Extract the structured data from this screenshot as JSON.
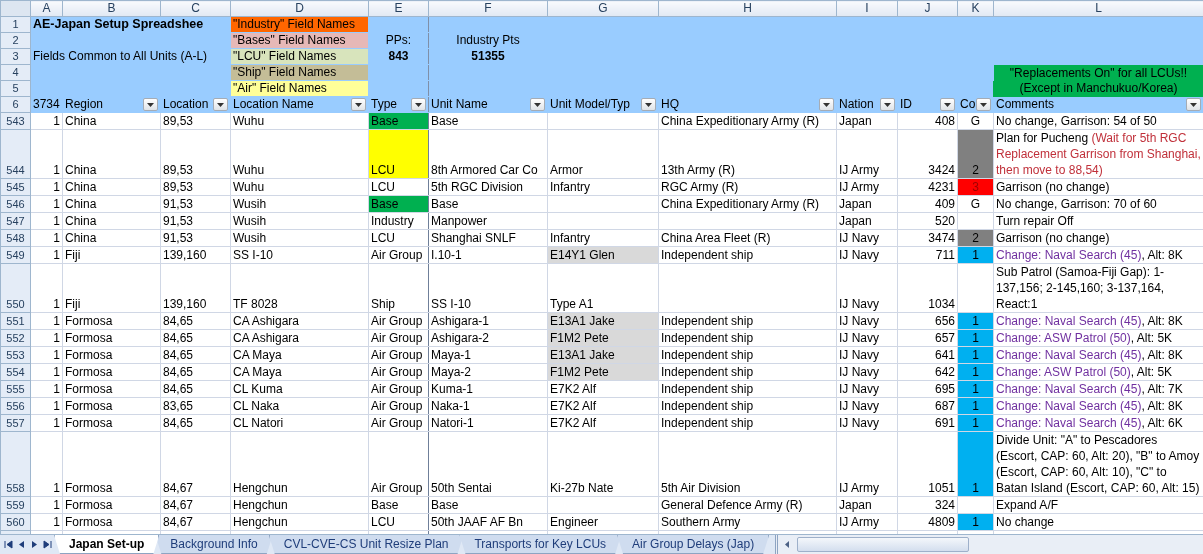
{
  "column_letters": [
    "A",
    "B",
    "C",
    "D",
    "E",
    "F",
    "G",
    "H",
    "I",
    "J",
    "K",
    "L"
  ],
  "header_row_numbers": [
    "1",
    "2",
    "3",
    "4",
    "5"
  ],
  "title": "AE-Japan Setup Spreadshee",
  "subtitle": "Fields Common to All Units (A-L)",
  "legend": [
    {
      "label": "\"Industry\" Field Names",
      "color": "#ff6600"
    },
    {
      "label": "\"Bases\" Field Names",
      "color": "#e6b8b7"
    },
    {
      "label": "\"LCU\" Field Names",
      "color": "#d8e4bc"
    },
    {
      "label": "\"Ship\" Field Names",
      "color": "#c4bd97"
    },
    {
      "label": "\"Air\" Field Names",
      "color": "#ffff99"
    }
  ],
  "pps": {
    "label": "PPs:",
    "value": "843"
  },
  "industry_pts": {
    "label": "Industry Pts",
    "value": "51355"
  },
  "banner": [
    "\"Replacements On\" for all LCUs!!",
    "(Except in Manchukuo/Korea)"
  ],
  "header_row": {
    "row_number": "6",
    "cells": [
      {
        "text": "3734",
        "filter": false
      },
      {
        "text": "Region",
        "filter": true
      },
      {
        "text": "Location",
        "filter": true
      },
      {
        "text": "Location Name",
        "filter": true
      },
      {
        "text": "Type",
        "filter": true
      },
      {
        "text": "Unit Name",
        "filter": true
      },
      {
        "text": "Unit Model/Typ",
        "filter": true
      },
      {
        "text": "HQ",
        "filter": true
      },
      {
        "text": "Nation",
        "filter": true
      },
      {
        "text": "ID",
        "filter": true
      },
      {
        "text": "Co",
        "filter": true
      },
      {
        "text": "Comments",
        "filter": true
      }
    ]
  },
  "rows": [
    {
      "row_number": "543",
      "count": "1",
      "region": "China",
      "location": "89,53",
      "location_name": "Wuhu",
      "type": {
        "text": "Base",
        "color": "#00b050"
      },
      "unit_name": "Base",
      "hq": "China Expeditionary Army (R)",
      "nation": "Japan",
      "id": "408",
      "co": {
        "text": "G"
      },
      "comment": [
        {
          "text": "No change, Garrison: 54 of 50",
          "kind": "plain"
        }
      ]
    },
    {
      "row_number": "544",
      "count": "1",
      "region": "China",
      "location": "89,53",
      "location_name": "Wuhu",
      "type": {
        "text": "LCU",
        "color": "#ffff00"
      },
      "unit_name": "8th Armored Car Co",
      "unit_model": {
        "text": "Armor"
      },
      "hq": "13th Army (R)",
      "nation": "IJ Army",
      "id": "3424",
      "co": {
        "text": "2",
        "color": "#808080"
      },
      "comment": [
        {
          "text": "Plan for Pucheng ",
          "kind": "plain"
        },
        {
          "text": "(Wait for 5th RGC Replacement Garrison from Shanghai, then move to 88,54)",
          "kind": "note"
        }
      ]
    },
    {
      "row_number": "545",
      "count": "1",
      "region": "China",
      "location": "89,53",
      "location_name": "Wuhu",
      "type": {
        "text": "LCU"
      },
      "unit_name": "5th RGC Division",
      "unit_model": {
        "text": "Infantry"
      },
      "hq": "RGC Army (R)",
      "nation": "IJ Army",
      "id": "4231",
      "co": {
        "text": "3",
        "color": "#ff0000"
      },
      "comment": [
        {
          "text": "Garrison (no change)",
          "kind": "plain"
        }
      ]
    },
    {
      "row_number": "546",
      "count": "1",
      "region": "China",
      "location": "91,53",
      "location_name": "Wusih",
      "type": {
        "text": "Base",
        "color": "#00b050"
      },
      "unit_name": "Base",
      "hq": "China Expeditionary Army (R)",
      "nation": "Japan",
      "id": "409",
      "co": {
        "text": "G"
      },
      "comment": [
        {
          "text": "No change, Garrison: 70 of 60",
          "kind": "plain"
        }
      ]
    },
    {
      "row_number": "547",
      "count": "1",
      "region": "China",
      "location": "91,53",
      "location_name": "Wusih",
      "type": {
        "text": "Industry"
      },
      "unit_name": "Manpower",
      "nation": "Japan",
      "id": "520",
      "comment": [
        {
          "text": "Turn repair Off",
          "kind": "plain"
        }
      ]
    },
    {
      "row_number": "548",
      "count": "1",
      "region": "China",
      "location": "91,53",
      "location_name": "Wusih",
      "type": {
        "text": "LCU"
      },
      "unit_name": "Shanghai SNLF",
      "unit_model": {
        "text": "Infantry"
      },
      "hq": "China Area Fleet (R)",
      "nation": "IJ Navy",
      "id": "3474",
      "co": {
        "text": "2",
        "color": "#808080"
      },
      "comment": [
        {
          "text": "Garrison (no change)",
          "kind": "plain"
        }
      ]
    },
    {
      "row_number": "549",
      "count": "1",
      "region": "Fiji",
      "location": "139,160",
      "location_name": "SS I-10",
      "type": {
        "text": "Air Group"
      },
      "unit_name": "I.10-1",
      "unit_model": {
        "text": "E14Y1 Glen",
        "color": "#d9d9d9"
      },
      "hq": "Independent ship",
      "nation": "IJ Navy",
      "id": "711",
      "co": {
        "text": "1",
        "color": "#00b0f0"
      },
      "comment": [
        {
          "text": "Change: Naval Search (45)",
          "kind": "change"
        },
        {
          "text": ", Alt: 8K",
          "kind": "plain"
        }
      ]
    },
    {
      "row_number": "550",
      "count": "1",
      "region": "Fiji",
      "location": "139,160",
      "location_name": "TF 8028",
      "type": {
        "text": "Ship"
      },
      "unit_name": "SS I-10",
      "unit_model": {
        "text": "Type A1"
      },
      "nation": "IJ Navy",
      "id": "1034",
      "comment": [
        {
          "text": "Sub Patrol (Samoa-Fiji Gap): 1-137,156; 2-145,160; 3-137,164, React:1",
          "kind": "plain"
        }
      ]
    },
    {
      "row_number": "551",
      "count": "1",
      "region": "Formosa",
      "location": "84,65",
      "location_name": "CA Ashigara",
      "type": {
        "text": "Air Group"
      },
      "unit_name": "Ashigara-1",
      "unit_model": {
        "text": "E13A1 Jake",
        "color": "#d9d9d9"
      },
      "hq": "Independent ship",
      "nation": "IJ Navy",
      "id": "656",
      "co": {
        "text": "1",
        "color": "#00b0f0"
      },
      "comment": [
        {
          "text": "Change: Naval Search (45)",
          "kind": "change"
        },
        {
          "text": ", Alt: 8K",
          "kind": "plain"
        }
      ]
    },
    {
      "row_number": "552",
      "count": "1",
      "region": "Formosa",
      "location": "84,65",
      "location_name": "CA Ashigara",
      "type": {
        "text": "Air Group"
      },
      "unit_name": "Ashigara-2",
      "unit_model": {
        "text": "F1M2 Pete",
        "color": "#d9d9d9"
      },
      "hq": "Independent ship",
      "nation": "IJ Navy",
      "id": "657",
      "co": {
        "text": "1",
        "color": "#00b0f0"
      },
      "comment": [
        {
          "text": "Change: ASW Patrol (50)",
          "kind": "change"
        },
        {
          "text": ", Alt: 5K",
          "kind": "plain"
        }
      ]
    },
    {
      "row_number": "553",
      "count": "1",
      "region": "Formosa",
      "location": "84,65",
      "location_name": "CA Maya",
      "type": {
        "text": "Air Group"
      },
      "unit_name": "Maya-1",
      "unit_model": {
        "text": "E13A1 Jake",
        "color": "#d9d9d9"
      },
      "hq": "Independent ship",
      "nation": "IJ Navy",
      "id": "641",
      "co": {
        "text": "1",
        "color": "#00b0f0"
      },
      "comment": [
        {
          "text": "Change: Naval Search (45)",
          "kind": "change"
        },
        {
          "text": ", Alt: 8K",
          "kind": "plain"
        }
      ]
    },
    {
      "row_number": "554",
      "count": "1",
      "region": "Formosa",
      "location": "84,65",
      "location_name": "CA Maya",
      "type": {
        "text": "Air Group"
      },
      "unit_name": "Maya-2",
      "unit_model": {
        "text": "F1M2 Pete",
        "color": "#d9d9d9"
      },
      "hq": "Independent ship",
      "nation": "IJ Navy",
      "id": "642",
      "co": {
        "text": "1",
        "color": "#00b0f0"
      },
      "comment": [
        {
          "text": "Change: ASW Patrol (50)",
          "kind": "change"
        },
        {
          "text": ", Alt: 5K",
          "kind": "plain"
        }
      ]
    },
    {
      "row_number": "555",
      "count": "1",
      "region": "Formosa",
      "location": "84,65",
      "location_name": "CL Kuma",
      "type": {
        "text": "Air Group"
      },
      "unit_name": "Kuma-1",
      "unit_model": {
        "text": "E7K2 Alf"
      },
      "hq": "Independent ship",
      "nation": "IJ Navy",
      "id": "695",
      "co": {
        "text": "1",
        "color": "#00b0f0"
      },
      "comment": [
        {
          "text": "Change: Naval Search (45)",
          "kind": "change"
        },
        {
          "text": ", Alt: 7K",
          "kind": "plain"
        }
      ]
    },
    {
      "row_number": "556",
      "count": "1",
      "region": "Formosa",
      "location": "83,65",
      "location_name": "CL Naka",
      "type": {
        "text": "Air Group"
      },
      "unit_name": "Naka-1",
      "unit_model": {
        "text": "E7K2 Alf"
      },
      "hq": "Independent ship",
      "nation": "IJ Navy",
      "id": "687",
      "co": {
        "text": "1",
        "color": "#00b0f0"
      },
      "comment": [
        {
          "text": "Change: Naval Search (45)",
          "kind": "change"
        },
        {
          "text": ", Alt: 8K",
          "kind": "plain"
        }
      ]
    },
    {
      "row_number": "557",
      "count": "1",
      "region": "Formosa",
      "location": "84,65",
      "location_name": "CL Natori",
      "type": {
        "text": "Air Group"
      },
      "unit_name": "Natori-1",
      "unit_model": {
        "text": "E7K2 Alf"
      },
      "hq": "Independent ship",
      "nation": "IJ Navy",
      "id": "691",
      "co": {
        "text": "1",
        "color": "#00b0f0"
      },
      "comment": [
        {
          "text": "Change: Naval Search (45)",
          "kind": "change"
        },
        {
          "text": ", Alt: 6K",
          "kind": "plain"
        }
      ]
    },
    {
      "row_number": "558",
      "count": "1",
      "region": "Formosa",
      "location": "84,67",
      "location_name": "Hengchun",
      "type": {
        "text": "Air Group"
      },
      "unit_name": "50th Sentai",
      "unit_model": {
        "text": "Ki-27b Nate"
      },
      "hq": "5th Air Division",
      "nation": "IJ Army",
      "id": "1051",
      "co": {
        "text": "1",
        "color": "#00b0f0"
      },
      "comment": [
        {
          "text": "Divide Unit: \"A\" to Pescadores (Escort, CAP: 60, Alt: 20), \"B\" to Amoy (Escort, CAP: 60, Alt: 10), \"C\" to Batan Island (Escort, CAP: 60, Alt: 15)",
          "kind": "plain"
        }
      ]
    },
    {
      "row_number": "559",
      "count": "1",
      "region": "Formosa",
      "location": "84,67",
      "location_name": "Hengchun",
      "type": {
        "text": "Base"
      },
      "unit_name": "Base",
      "hq": "General Defence Army (R)",
      "nation": "Japan",
      "id": "324",
      "comment": [
        {
          "text": "Expand A/F",
          "kind": "plain"
        }
      ]
    },
    {
      "row_number": "560",
      "count": "1",
      "region": "Formosa",
      "location": "84,67",
      "location_name": "Hengchun",
      "type": {
        "text": "LCU"
      },
      "unit_name": "50th JAAF AF Bn",
      "unit_model": {
        "text": "Engineer"
      },
      "hq": "Southern Army",
      "nation": "IJ Army",
      "id": "4809",
      "co": {
        "text": "1",
        "color": "#00b0f0"
      },
      "comment": [
        {
          "text": "No change",
          "kind": "plain"
        }
      ]
    }
  ],
  "sheet_tabs": [
    {
      "label": "Japan Set-up",
      "selected": true
    },
    {
      "label": "Background Info",
      "selected": false
    },
    {
      "label": "CVL-CVE-CS Unit Resize Plan",
      "selected": false
    },
    {
      "label": "Transports for Key LCUs",
      "selected": false
    },
    {
      "label": "Air Group Delays (Jap)",
      "selected": false
    }
  ]
}
